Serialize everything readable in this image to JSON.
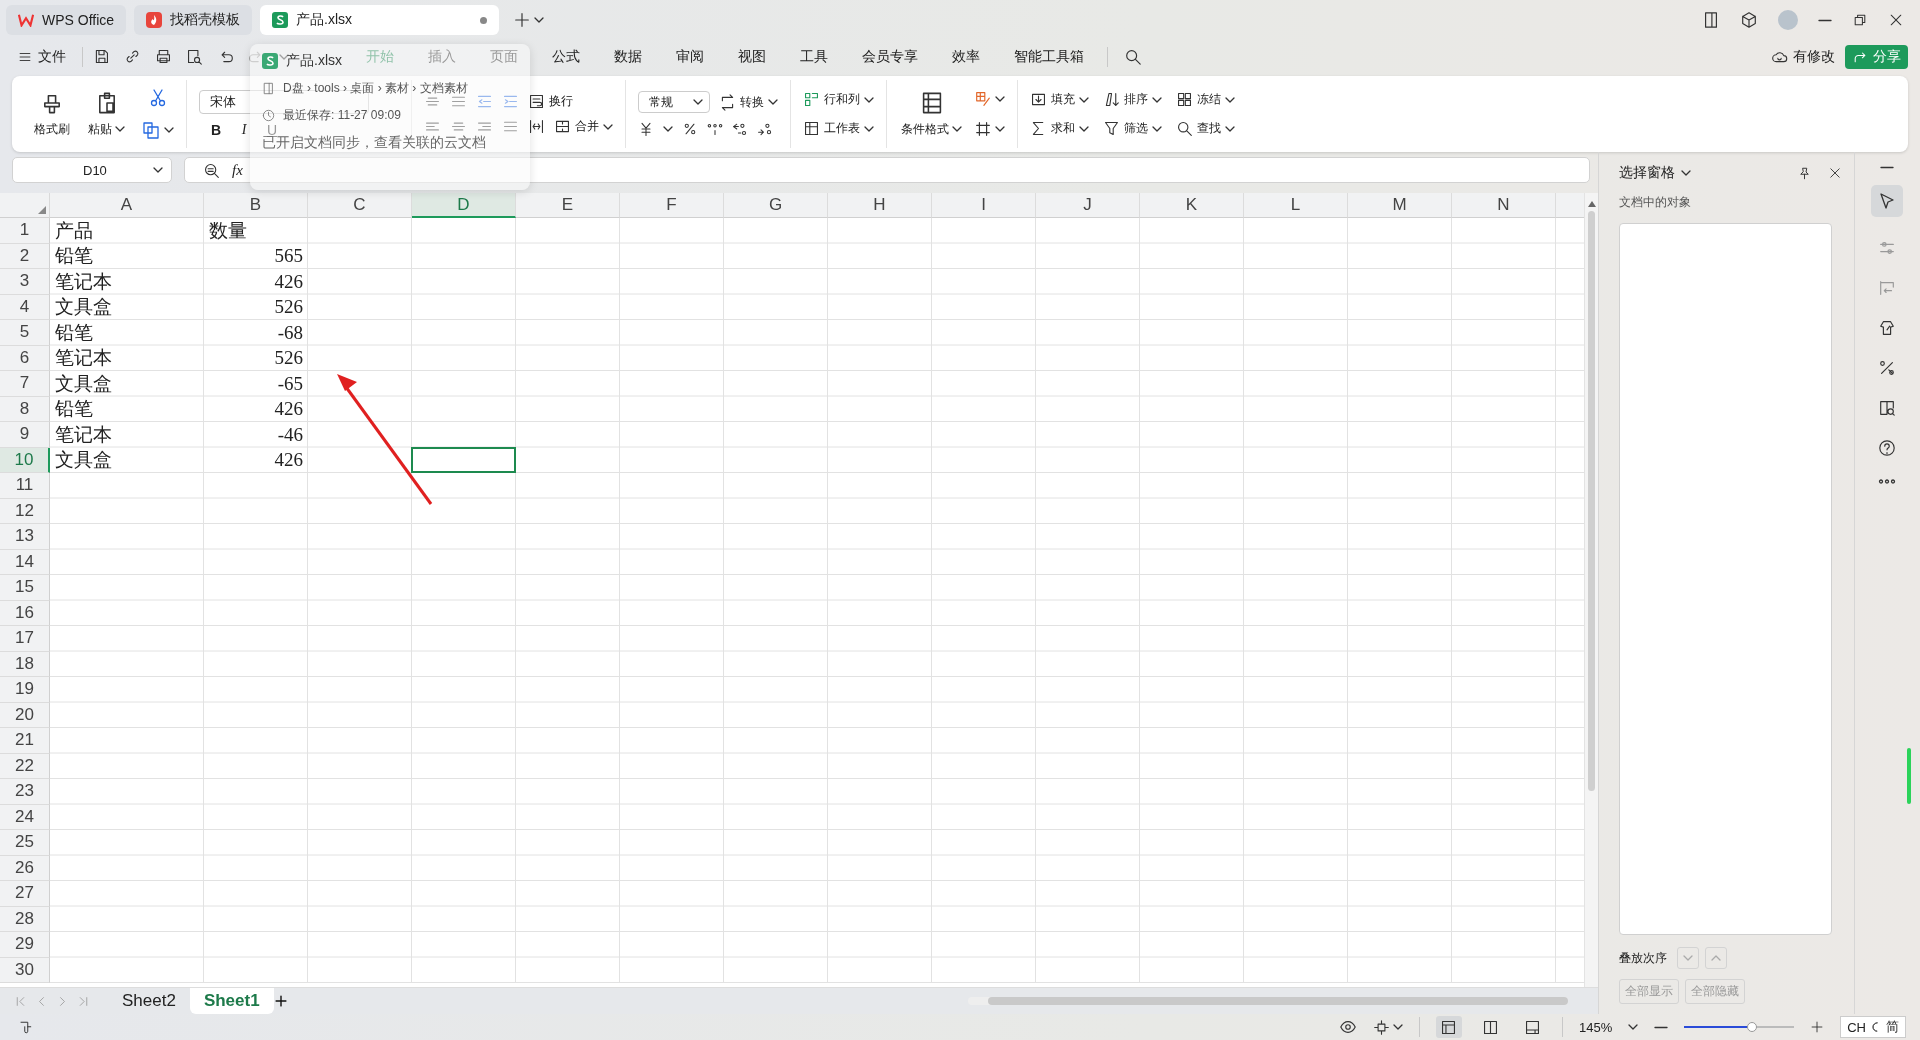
{
  "title_tabs": [
    {
      "label": "WPS Office",
      "kind": "home",
      "selected": false,
      "unsaved": false
    },
    {
      "label": "找稻壳模板",
      "kind": "docer",
      "selected": false,
      "unsaved": false
    },
    {
      "label": "产品.xlsx",
      "kind": "sheet",
      "selected": true,
      "unsaved": true
    }
  ],
  "menu": {
    "file": "文件",
    "tabs": [
      {
        "label": "开始",
        "selected": true
      },
      {
        "label": "插入",
        "selected": false
      },
      {
        "label": "页面",
        "selected": false
      },
      {
        "label": "公式",
        "selected": false
      },
      {
        "label": "数据",
        "selected": false
      },
      {
        "label": "审阅",
        "selected": false
      },
      {
        "label": "视图",
        "selected": false
      },
      {
        "label": "工具",
        "selected": false
      },
      {
        "label": "会员专享",
        "selected": false
      },
      {
        "label": "效率",
        "selected": false
      },
      {
        "label": "智能工具箱",
        "selected": false
      }
    ],
    "sync_status": "有修改",
    "share": "分享"
  },
  "ribbon": {
    "format_painter": "格式刷",
    "paste": "粘贴",
    "font": "宋体",
    "bold": "B",
    "italic": "I",
    "underline": "U",
    "wrap": "换行",
    "merge": "合并",
    "number_format": "常规",
    "convert": "转换",
    "rows_cols": "行和列",
    "worksheet": "工作表",
    "conditional_format": "条件格式",
    "fill": "填充",
    "sort": "排序",
    "freeze": "冻结",
    "sum": "求和",
    "filter": "筛选",
    "find": "查找"
  },
  "file_popup": {
    "name": "产品.xlsx",
    "path": "D盘 › tools › 桌面 › 素材 › 文档素材",
    "saved": "最近保存: 11-27 09:09",
    "sync": "已开启文档同步，查看关联的云文档"
  },
  "formula_bar": {
    "cell": "D10",
    "fx": "fx"
  },
  "sheet": {
    "columns": [
      {
        "label": "A",
        "selected": false
      },
      {
        "label": "B",
        "selected": false
      },
      {
        "label": "C",
        "selected": false
      },
      {
        "label": "D",
        "selected": true
      },
      {
        "label": "E",
        "selected": false
      },
      {
        "label": "F",
        "selected": false
      },
      {
        "label": "G",
        "selected": false
      },
      {
        "label": "H",
        "selected": false
      },
      {
        "label": "I",
        "selected": false
      },
      {
        "label": "J",
        "selected": false
      },
      {
        "label": "K",
        "selected": false
      },
      {
        "label": "L",
        "selected": false
      },
      {
        "label": "M",
        "selected": false
      },
      {
        "label": "N",
        "selected": false
      }
    ],
    "rows": [
      {
        "header": "1",
        "selected": false,
        "cells": [
          {
            "text": "产品",
            "kind": "text"
          },
          {
            "text": "数量",
            "kind": "text"
          }
        ]
      },
      {
        "header": "2",
        "selected": false,
        "cells": [
          {
            "text": "铅笔",
            "kind": "text"
          },
          {
            "text": "565",
            "kind": "number"
          }
        ]
      },
      {
        "header": "3",
        "selected": false,
        "cells": [
          {
            "text": "笔记本",
            "kind": "text"
          },
          {
            "text": "426",
            "kind": "number"
          }
        ]
      },
      {
        "header": "4",
        "selected": false,
        "cells": [
          {
            "text": "文具盒",
            "kind": "text"
          },
          {
            "text": "526",
            "kind": "number"
          }
        ]
      },
      {
        "header": "5",
        "selected": false,
        "cells": [
          {
            "text": "铅笔",
            "kind": "text"
          },
          {
            "text": "-68",
            "kind": "number"
          }
        ]
      },
      {
        "header": "6",
        "selected": false,
        "cells": [
          {
            "text": "笔记本",
            "kind": "text"
          },
          {
            "text": "526",
            "kind": "number"
          }
        ]
      },
      {
        "header": "7",
        "selected": false,
        "cells": [
          {
            "text": "文具盒",
            "kind": "text"
          },
          {
            "text": "-65",
            "kind": "number"
          }
        ]
      },
      {
        "header": "8",
        "selected": false,
        "cells": [
          {
            "text": "铅笔",
            "kind": "text"
          },
          {
            "text": "426",
            "kind": "number"
          }
        ]
      },
      {
        "header": "9",
        "selected": false,
        "cells": [
          {
            "text": "笔记本",
            "kind": "text"
          },
          {
            "text": "-46",
            "kind": "number"
          }
        ]
      },
      {
        "header": "10",
        "selected": true,
        "cells": [
          {
            "text": "文具盒",
            "kind": "text"
          },
          {
            "text": "426",
            "kind": "number"
          }
        ]
      },
      {
        "header": "11",
        "selected": false,
        "cells": []
      },
      {
        "header": "12",
        "selected": false,
        "cells": []
      },
      {
        "header": "13",
        "selected": false,
        "cells": []
      },
      {
        "header": "14",
        "selected": false,
        "cells": []
      },
      {
        "header": "15",
        "selected": false,
        "cells": []
      },
      {
        "header": "16",
        "selected": false,
        "cells": []
      },
      {
        "header": "17",
        "selected": false,
        "cells": []
      },
      {
        "header": "18",
        "selected": false,
        "cells": []
      },
      {
        "header": "19",
        "selected": false,
        "cells": []
      },
      {
        "header": "20",
        "selected": false,
        "cells": []
      },
      {
        "header": "21",
        "selected": false,
        "cells": []
      },
      {
        "header": "22",
        "selected": false,
        "cells": []
      },
      {
        "header": "23",
        "selected": false,
        "cells": []
      },
      {
        "header": "24",
        "selected": false,
        "cells": []
      },
      {
        "header": "25",
        "selected": false,
        "cells": []
      },
      {
        "header": "26",
        "selected": false,
        "cells": []
      },
      {
        "header": "27",
        "selected": false,
        "cells": []
      },
      {
        "header": "28",
        "selected": false,
        "cells": []
      },
      {
        "header": "29",
        "selected": false,
        "cells": []
      },
      {
        "header": "30",
        "selected": false,
        "cells": []
      }
    ]
  },
  "sheet_tabs": [
    {
      "label": "Sheet2",
      "selected": false
    },
    {
      "label": "Sheet1",
      "selected": true
    }
  ],
  "selection_pane": {
    "title": "选择窗格",
    "subtitle": "文档中的对象",
    "order_label": "叠放次序",
    "buttons": [
      {
        "label": "全部显示",
        "disabled": true
      },
      {
        "label": "全部隐藏",
        "disabled": true
      }
    ]
  },
  "status_bar": {
    "view_modes": [
      {
        "selected": true
      },
      {
        "selected": false
      },
      {
        "selected": false
      }
    ],
    "zoom": "145%",
    "zoom_slider": {
      "level": 0.62
    },
    "ime": {
      "mode": "CH",
      "script": "简"
    }
  }
}
